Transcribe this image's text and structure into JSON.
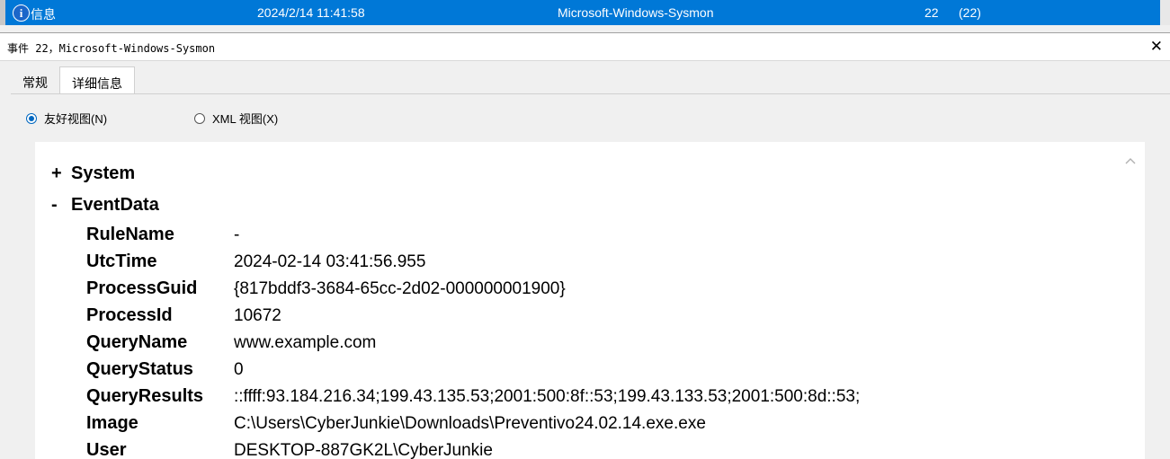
{
  "event_row": {
    "level": "信息",
    "datetime": "2024/2/14 11:41:58",
    "source": "Microsoft-Windows-Sysmon",
    "event_id": "22",
    "task_category": "(22)"
  },
  "panel": {
    "title": "事件 22，Microsoft-Windows-Sysmon"
  },
  "tabs": [
    {
      "label": "常规",
      "active": false
    },
    {
      "label": "详细信息",
      "active": true
    }
  ],
  "view_options": {
    "friendly": "友好视图(N)",
    "xml": "XML 视图(X)",
    "selected": "friendly"
  },
  "tree": {
    "system": {
      "toggle": "+",
      "label": "System"
    },
    "eventdata": {
      "toggle": "-",
      "label": "EventData"
    },
    "fields": [
      {
        "name": "RuleName",
        "value": "-"
      },
      {
        "name": "UtcTime",
        "value": "2024-02-14 03:41:56.955"
      },
      {
        "name": "ProcessGuid",
        "value": "{817bddf3-3684-65cc-2d02-000000001900}"
      },
      {
        "name": "ProcessId",
        "value": "10672"
      },
      {
        "name": "QueryName",
        "value": "www.example.com"
      },
      {
        "name": "QueryStatus",
        "value": "0"
      },
      {
        "name": "QueryResults",
        "value": "::ffff:93.184.216.34;199.43.135.53;2001:500:8f::53;199.43.133.53;2001:500:8d::53;"
      },
      {
        "name": "Image",
        "value": "C:\\Users\\CyberJunkie\\Downloads\\Preventivo24.02.14.exe.exe"
      },
      {
        "name": "User",
        "value": "DESKTOP-887GK2L\\CyberJunkie"
      }
    ]
  },
  "colors": {
    "selection": "#0078d7",
    "radio_accent": "#0067c0"
  }
}
